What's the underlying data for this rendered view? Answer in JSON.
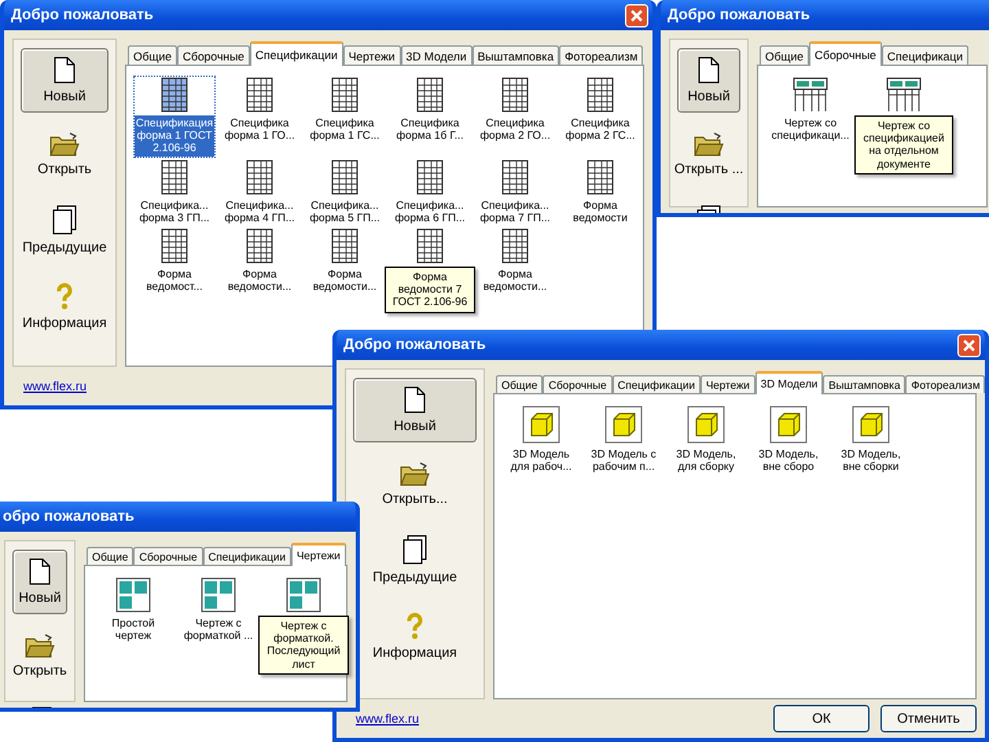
{
  "windows": [
    {
      "title": "Добро пожаловать",
      "close_button": true,
      "link": "www.flex.ru",
      "sidebar": [
        {
          "kind": "new",
          "label": "Новый",
          "selected": true
        },
        {
          "kind": "open",
          "label": "Открыть",
          "selected": false
        },
        {
          "kind": "recent",
          "label": "Предыдущие",
          "selected": false
        },
        {
          "kind": "info",
          "label": "Информация",
          "selected": false
        }
      ],
      "tabs": [
        {
          "label": "Общие",
          "selected": false
        },
        {
          "label": "Сборочные",
          "selected": false
        },
        {
          "label": "Спецификации",
          "selected": true
        },
        {
          "label": "Чертежи",
          "selected": false
        },
        {
          "label": "3D Модели",
          "selected": false
        },
        {
          "label": "Выштамповка",
          "selected": false
        },
        {
          "label": "Фотореализм",
          "selected": false
        }
      ],
      "items": [
        {
          "kind": "spec",
          "label": "Спецификация форма 1 ГОСТ 2.106-96",
          "selected": true,
          "hovered": false
        },
        {
          "kind": "spec",
          "label": "Специфика форма 1 ГО...",
          "selected": false,
          "hovered": false
        },
        {
          "kind": "spec",
          "label": "Специфика форма 1 ГС...",
          "selected": false,
          "hovered": false
        },
        {
          "kind": "spec",
          "label": "Специфика форма 1б Г...",
          "selected": false,
          "hovered": false
        },
        {
          "kind": "spec",
          "label": "Специфика форма 2 ГО...",
          "selected": false,
          "hovered": false
        },
        {
          "kind": "spec",
          "label": "Специфика форма 2 ГС...",
          "selected": false,
          "hovered": false
        },
        {
          "kind": "spec",
          "label": "Специфика... форма 3 ГП...",
          "selected": false,
          "hovered": false
        },
        {
          "kind": "spec",
          "label": "Специфика... форма 4 ГП...",
          "selected": false,
          "hovered": false
        },
        {
          "kind": "spec",
          "label": "Специфика... форма 5 ГП...",
          "selected": false,
          "hovered": false
        },
        {
          "kind": "spec",
          "label": "Специфика... форма 6 ГП...",
          "selected": false,
          "hovered": false
        },
        {
          "kind": "spec",
          "label": "Специфика... форма 7 ГП...",
          "selected": false,
          "hovered": false
        },
        {
          "kind": "spec",
          "label": "Форма ведомости",
          "selected": false,
          "hovered": false
        },
        {
          "kind": "spec",
          "label": "Форма ведомост...",
          "selected": false,
          "hovered": false
        },
        {
          "kind": "spec",
          "label": "Форма ведомости...",
          "selected": false,
          "hovered": false
        },
        {
          "kind": "spec",
          "label": "Форма ведомости...",
          "selected": false,
          "hovered": false
        },
        {
          "kind": "spec",
          "label": "Форма ведомости 7 ГОСТ 2.106-96",
          "selected": false,
          "hovered": true
        },
        {
          "kind": "spec",
          "label": "Форма ведомости...",
          "selected": false,
          "hovered": false
        }
      ]
    },
    {
      "title": "Добро пожаловать",
      "sidebar": [
        {
          "kind": "new",
          "label": "Новый",
          "selected": true
        },
        {
          "kind": "open",
          "label": "Открыть ...",
          "selected": false
        },
        {
          "kind": "recent",
          "selected": false
        }
      ],
      "tabs": [
        {
          "label": "Общие",
          "selected": false
        },
        {
          "label": "Сборочные",
          "selected": true
        },
        {
          "label": "Спецификаци",
          "selected": false
        }
      ],
      "items": [
        {
          "kind": "assembly",
          "label": "Чертеж со спецификаци...",
          "selected": false,
          "hovered": false
        },
        {
          "kind": "assembly",
          "label": "Чертеж со спецификацией на отдельном документе",
          "selected": false,
          "hovered": true
        }
      ]
    },
    {
      "title": "Добро пожаловать",
      "close_button": true,
      "link": "www.flex.ru",
      "buttons": [
        "ОК",
        "Отменить"
      ],
      "sidebar": [
        {
          "kind": "new",
          "label": "Новый",
          "selected": true
        },
        {
          "kind": "open",
          "label": "Открыть...",
          "selected": false
        },
        {
          "kind": "recent",
          "label": "Предыдущие",
          "selected": false
        },
        {
          "kind": "info",
          "label": "Информация",
          "selected": false
        }
      ],
      "tabs": [
        {
          "label": "Общие",
          "selected": false
        },
        {
          "label": "Сборочные",
          "selected": false
        },
        {
          "label": "Спецификации",
          "selected": false
        },
        {
          "label": "Чертежи",
          "selected": false
        },
        {
          "label": "3D Модели",
          "selected": true
        },
        {
          "label": "Выштамповка",
          "selected": false
        },
        {
          "label": "Фотореализм",
          "selected": false
        }
      ],
      "items": [
        {
          "kind": "model",
          "label": "3D Модель для рабоч...",
          "selected": false,
          "hovered": false
        },
        {
          "kind": "model",
          "label": "3D Модель с рабочим п...",
          "selected": false,
          "hovered": false
        },
        {
          "kind": "model",
          "label": "3D Модель, для сборку",
          "selected": false,
          "hovered": false
        },
        {
          "kind": "model",
          "label": "3D Модель, вне сборо",
          "selected": false,
          "hovered": false
        },
        {
          "kind": "model",
          "label": "3D Модель, вне сборки",
          "selected": false,
          "hovered": false
        }
      ]
    },
    {
      "title": "обро пожаловать",
      "sidebar": [
        {
          "kind": "new",
          "label": "Новый",
          "selected": true
        },
        {
          "kind": "open",
          "label": "Открыть",
          "selected": false
        },
        {
          "kind": "recent",
          "selected": false
        }
      ],
      "tabs": [
        {
          "label": "Общие",
          "selected": false
        },
        {
          "label": "Сборочные",
          "selected": false
        },
        {
          "label": "Спецификации",
          "selected": false
        },
        {
          "label": "Чертежи",
          "selected": true
        }
      ],
      "items": [
        {
          "kind": "drawing",
          "label": "Простой чертеж",
          "selected": false,
          "hovered": false
        },
        {
          "kind": "drawing",
          "label": "Чертеж с форматкой ...",
          "selected": false,
          "hovered": false
        },
        {
          "kind": "drawing",
          "label": "Чертеж с форматкой. Последующий лист",
          "selected": false,
          "hovered": true
        }
      ]
    }
  ]
}
